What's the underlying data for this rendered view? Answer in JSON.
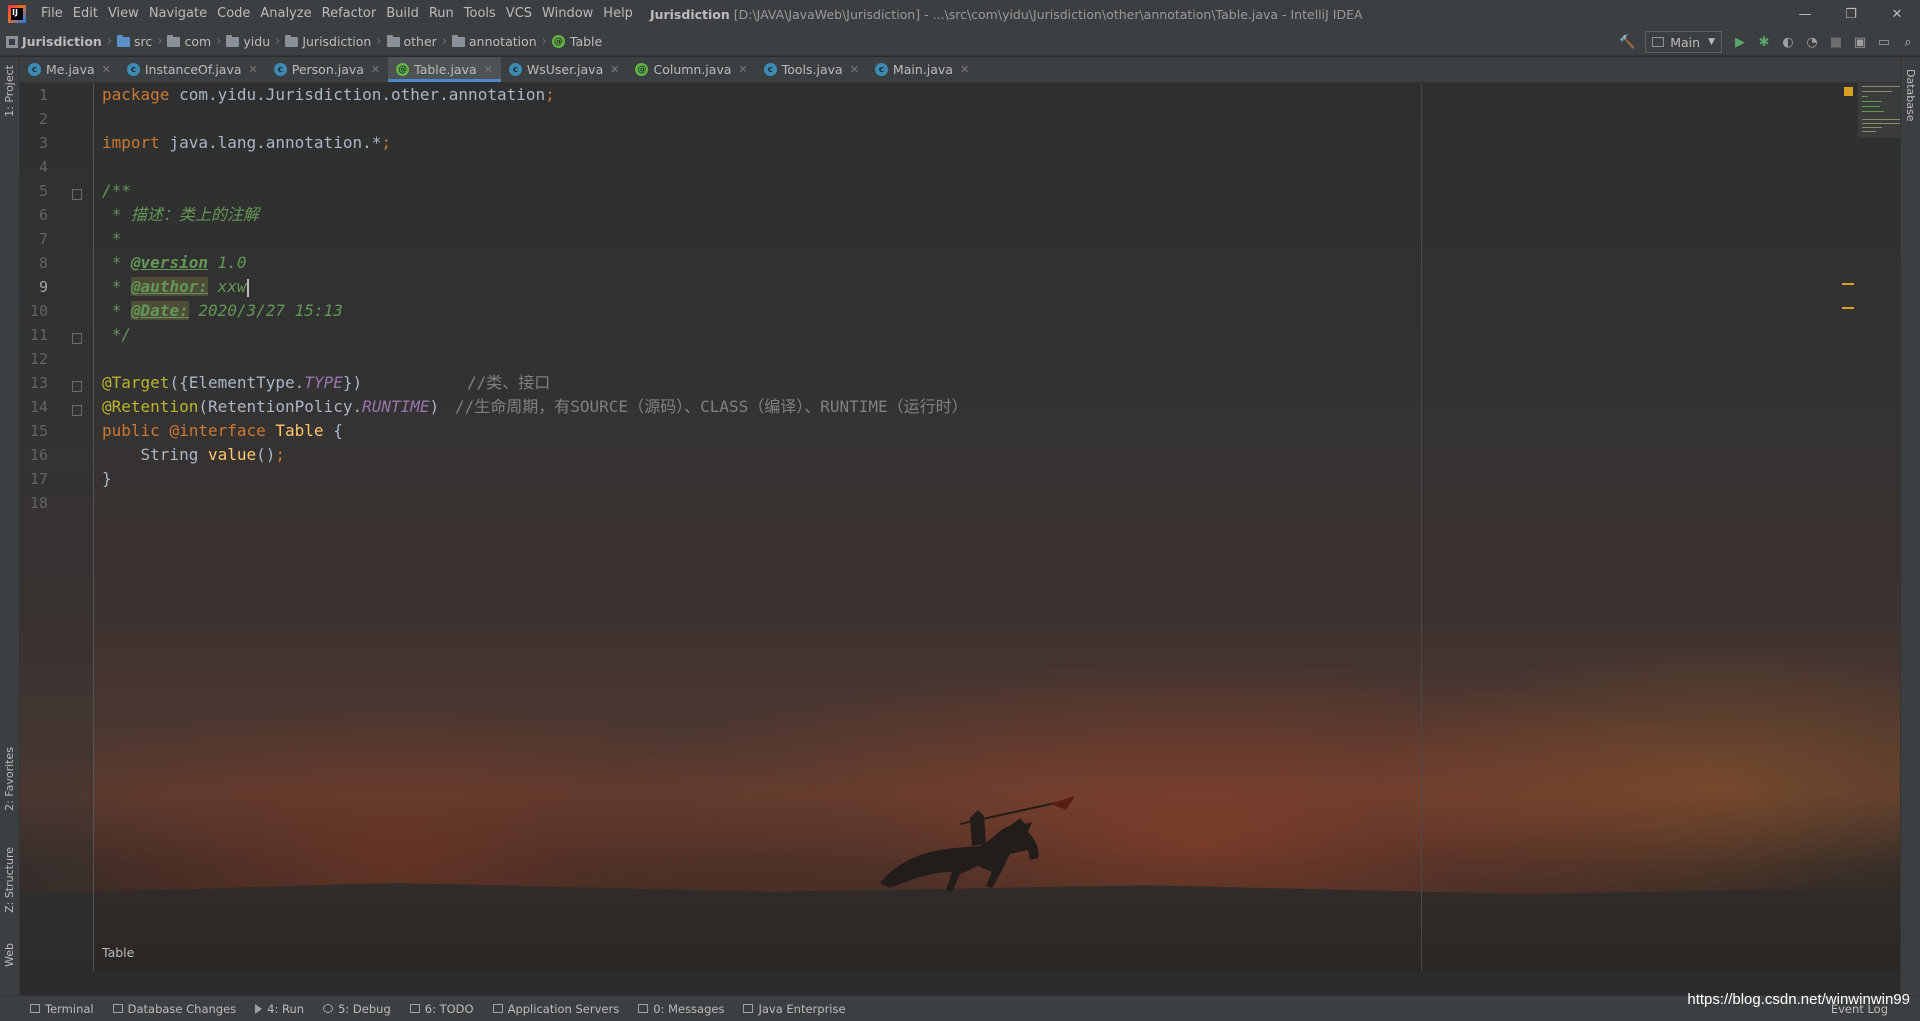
{
  "app": {
    "logo_text": "IJ",
    "menu": [
      "File",
      "Edit",
      "View",
      "Navigate",
      "Code",
      "Analyze",
      "Refactor",
      "Build",
      "Run",
      "Tools",
      "VCS",
      "Window",
      "Help"
    ],
    "title_project": "Jurisdiction",
    "title_rest": "[D:\\JAVA\\JavaWeb\\Jurisdiction] - ...\\src\\com\\yidu\\Jurisdiction\\other\\annotation\\Table.java - IntelliJ IDEA",
    "window_controls": [
      "—",
      "❐",
      "✕"
    ]
  },
  "navbar": {
    "breadcrumbs": [
      "Jurisdiction",
      "src",
      "com",
      "yidu",
      "Jurisdiction",
      "other",
      "annotation",
      "Table"
    ],
    "run_config": "Main",
    "icons": [
      "build-hammer-icon",
      "run-icon",
      "debug-icon",
      "coverage-icon",
      "profile-icon",
      "stop-icon",
      "project-structure-icon",
      "layout-icon",
      "search-everywhere-icon"
    ]
  },
  "tabs": [
    {
      "label": "Me.java",
      "kind": "class",
      "active": false
    },
    {
      "label": "InstanceOf.java",
      "kind": "class",
      "active": false
    },
    {
      "label": "Person.java",
      "kind": "class",
      "active": false
    },
    {
      "label": "Table.java",
      "kind": "annotation",
      "active": true
    },
    {
      "label": "WsUser.java",
      "kind": "class",
      "active": false
    },
    {
      "label": "Column.java",
      "kind": "annotation",
      "active": false
    },
    {
      "label": "Tools.java",
      "kind": "class",
      "active": false
    },
    {
      "label": "Main.java",
      "kind": "class",
      "active": false
    }
  ],
  "side": {
    "project": "1: Project",
    "favorites": "2: Favorites",
    "structure": "Z: Structure",
    "web": "Web",
    "database": "Database"
  },
  "editor": {
    "line_numbers": [
      "1",
      "2",
      "3",
      "4",
      "5",
      "6",
      "7",
      "8",
      "9",
      "10",
      "11",
      "12",
      "13",
      "14",
      "15",
      "16",
      "17",
      "18"
    ],
    "current_line": 9,
    "lines": {
      "l1_kw": "package",
      "l1_rest": " com.yidu.Jurisdiction.other.annotation",
      "l1_semi": ";",
      "l3_kw": "import",
      "l3_rest": " java.lang.annotation.*",
      "l3_semi": ";",
      "l5": "/**",
      "l6": " * 描述：类上的注解",
      "l7": " *",
      "l8_star": " * ",
      "l8_tag": "@version",
      "l8_val": " 1.0",
      "l9_star": " * ",
      "l9_tag": "@author:",
      "l9_val": " xxw",
      "l10_star": " * ",
      "l10_tag": "@Date:",
      "l10_val": " 2020/3/27 15:13",
      "l11": " */",
      "l13_ann": "@Target",
      "l13_a": "({ElementType.",
      "l13_const": "TYPE",
      "l13_b": "})",
      "l13_cmt": "//类、接口",
      "l14_ann": "@Retention",
      "l14_a": "(RetentionPolicy.",
      "l14_const": "RUNTIME",
      "l14_b": ")",
      "l14_cmt": "//生命周期，有SOURCE（源码）、CLASS（编译）、RUNTIME（运行时）",
      "l15_kw1": "public",
      "l15_kw2": "@interface",
      "l15_name": " Table",
      "l15_brace": " {",
      "l16_type": "    String ",
      "l16_fn": "value",
      "l16_paren": "()",
      "l16_semi": ";",
      "l17": "}"
    },
    "footer_breadcrumb": "Table"
  },
  "bottom_tools": [
    {
      "label": "Terminal",
      "icon": "terminal-icon"
    },
    {
      "label": "Database Changes",
      "icon": "database-changes-icon"
    },
    {
      "label": "4: Run",
      "icon": "run-icon"
    },
    {
      "label": "5: Debug",
      "icon": "debug-icon"
    },
    {
      "label": "6: TODO",
      "icon": "todo-icon"
    },
    {
      "label": "Application Servers",
      "icon": "app-servers-icon"
    },
    {
      "label": "0: Messages",
      "icon": "messages-icon"
    },
    {
      "label": "Java Enterprise",
      "icon": "java-enterprise-icon"
    }
  ],
  "event_log": "Event Log",
  "watermark": "https://blog.csdn.net/winwinwin99",
  "colors": {
    "keyword": "#cc7832",
    "doc_comment": "#629755",
    "annotation": "#bbb529",
    "constant": "#9876aa",
    "comment": "#808080",
    "method": "#ffc66d",
    "active_tab_underline": "#4a88c7"
  }
}
